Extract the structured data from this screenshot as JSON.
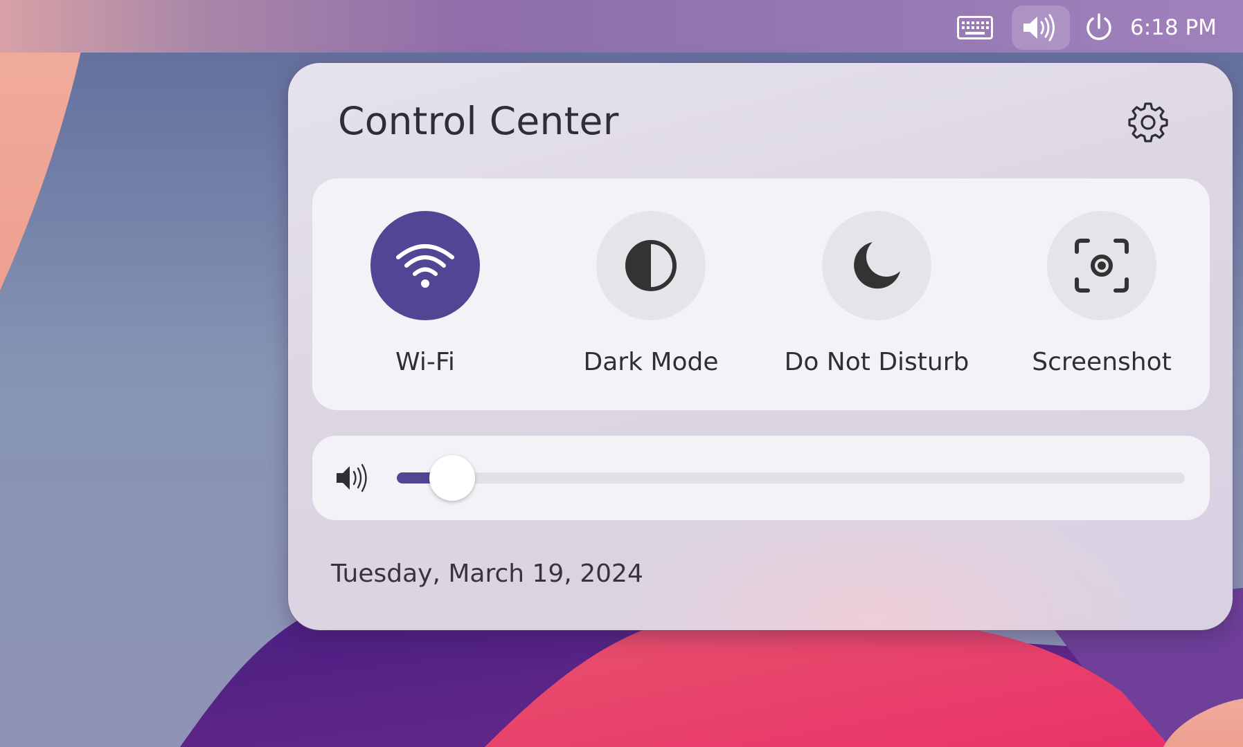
{
  "topbar": {
    "icons": [
      "keyboard-icon",
      "volume-icon",
      "power-icon"
    ],
    "clock": "6:18 PM"
  },
  "control_center": {
    "title": "Control Center",
    "settings_icon": "gear-icon",
    "toggles": [
      {
        "label": "Wi-Fi",
        "icon": "wifi-icon",
        "active": true
      },
      {
        "label": "Dark Mode",
        "icon": "contrast-icon",
        "active": false
      },
      {
        "label": "Do Not Disturb",
        "icon": "moon-icon",
        "active": false
      },
      {
        "label": "Screenshot",
        "icon": "screenshot-icon",
        "active": false
      }
    ],
    "volume": {
      "icon": "volume-icon",
      "level_fraction": 0.05
    },
    "date": "Tuesday, March 19, 2024"
  },
  "colors": {
    "accent": "#534594",
    "panel": "#e3dfe9",
    "card": "#f3f2f6",
    "inactive_toggle": "#e5e4e8"
  }
}
